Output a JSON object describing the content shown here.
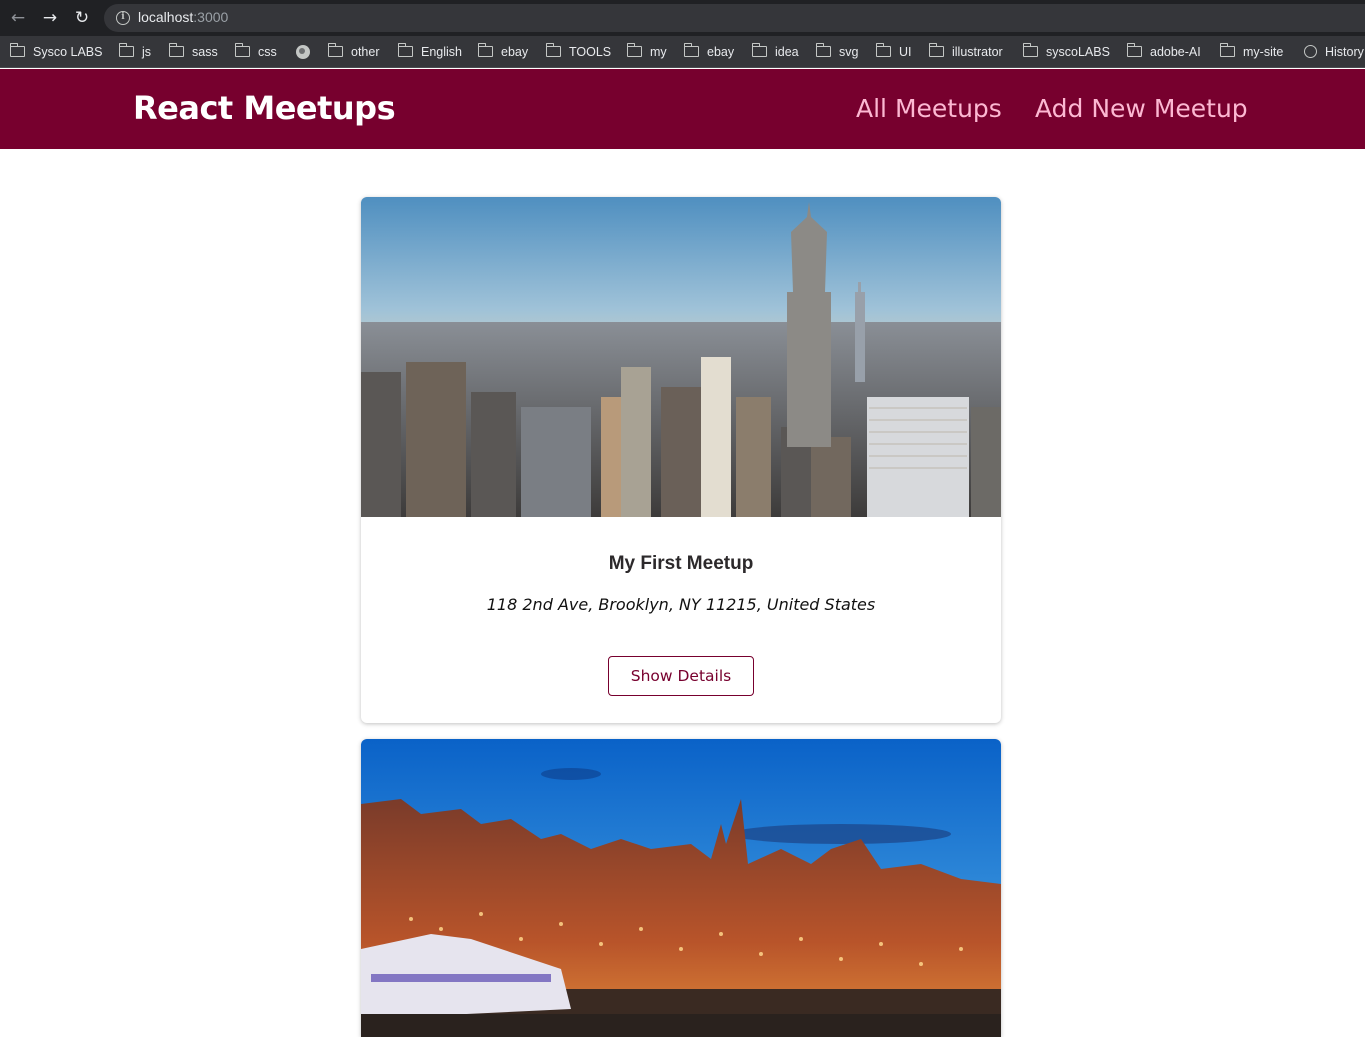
{
  "browser": {
    "url_host": "localhost",
    "url_port": ":3000",
    "bookmarks": [
      {
        "label": "Sysco LABS",
        "icon": "folder-icon"
      },
      {
        "label": "js",
        "icon": "folder-icon"
      },
      {
        "label": "sass",
        "icon": "folder-icon"
      },
      {
        "label": "css",
        "icon": "folder-icon"
      },
      {
        "label": "",
        "icon": "globe-icon"
      },
      {
        "label": "other",
        "icon": "folder-icon"
      },
      {
        "label": "English",
        "icon": "folder-icon"
      },
      {
        "label": "ebay",
        "icon": "folder-icon"
      },
      {
        "label": "TOOLS",
        "icon": "folder-icon"
      },
      {
        "label": "my",
        "icon": "folder-icon"
      },
      {
        "label": "ebay",
        "icon": "folder-icon"
      },
      {
        "label": "idea",
        "icon": "folder-icon"
      },
      {
        "label": "svg",
        "icon": "folder-icon"
      },
      {
        "label": "UI",
        "icon": "folder-icon"
      },
      {
        "label": "illustrator",
        "icon": "folder-icon"
      },
      {
        "label": "syscoLABS",
        "icon": "folder-icon"
      },
      {
        "label": "adobe-AI",
        "icon": "folder-icon"
      },
      {
        "label": "my-site",
        "icon": "folder-icon"
      },
      {
        "label": "History",
        "icon": "history-icon"
      }
    ]
  },
  "header": {
    "logo": "React Meetups",
    "nav": [
      {
        "label": "All Meetups"
      },
      {
        "label": "Add New Meetup"
      }
    ],
    "bg_color": "#77002e",
    "link_color": "#fcb8d2"
  },
  "meetups": [
    {
      "title": "My First Meetup",
      "address": "118 2nd Ave, Brooklyn, NY 11215, United States",
      "button": "Show Details",
      "image": "city-skyline-photo"
    },
    {
      "image": "harbor-night-photo"
    }
  ]
}
